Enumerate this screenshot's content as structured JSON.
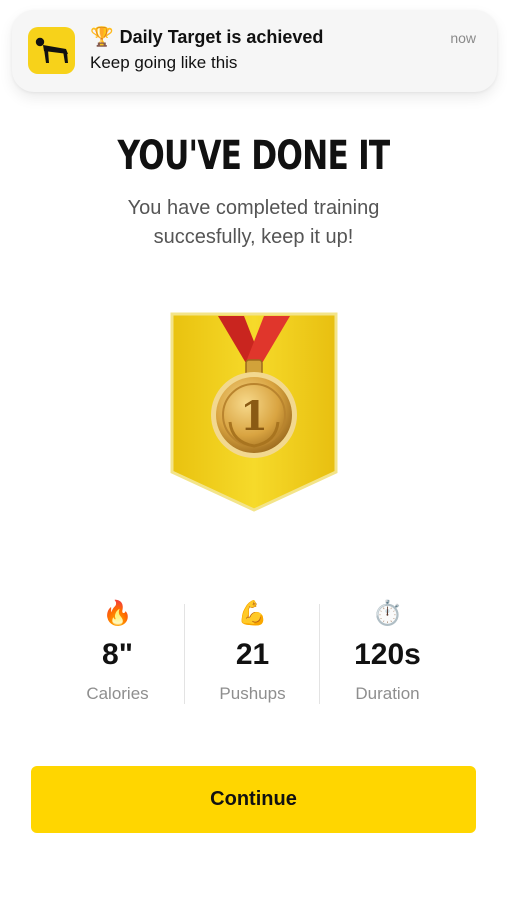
{
  "notification": {
    "title": "Daily Target is achieved",
    "message": "Keep going like this",
    "time": "now",
    "title_icon": "trophy-icon",
    "app_icon": "pushup-figure-icon",
    "app_icon_color": "#f7d21a"
  },
  "main": {
    "headline": "YOU'VE DONE IT",
    "subtitle_line1": "You have completed training",
    "subtitle_line2": "succesfully, keep it up!",
    "medal_number": "1",
    "badge_color": "#f1cc1a",
    "ribbon_color": "#d62f27"
  },
  "stats": [
    {
      "icon": "fire-icon",
      "emoji": "🔥",
      "value": "8\"",
      "label": "Calories"
    },
    {
      "icon": "flexed-biceps-icon",
      "emoji": "💪",
      "value": "21",
      "label": "Pushups"
    },
    {
      "icon": "stopwatch-icon",
      "emoji": "⏱️",
      "value": "120s",
      "label": "Duration"
    }
  ],
  "actions": {
    "continue_label": "Continue",
    "accent_color": "#ffd600"
  }
}
